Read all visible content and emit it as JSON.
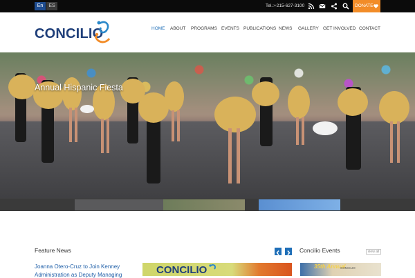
{
  "topbar": {
    "languages": [
      "En",
      "ES"
    ],
    "phone": "Tel.:+215-627-3100",
    "icons": [
      "rss-icon",
      "email-icon",
      "share-icon",
      "search-icon"
    ],
    "donate_label": "DONATE",
    "colors": {
      "bar": "#0b0b0b",
      "donate": "#f28c28",
      "lang_active": "#1f4d91"
    }
  },
  "header": {
    "logo_text": "CONCILIO",
    "nav": [
      "HOME",
      "ABOUT",
      "PROGRAMS",
      "EVENTS",
      "PUBLICATIONS",
      "NEWS",
      "GALLERY",
      "GET INVOLVED",
      "CONTACT"
    ],
    "active_nav": "HOME",
    "colors": {
      "brand": "#1f3f7a",
      "active": "#1f6fb8",
      "logo_orange": "#f28c28",
      "logo_blue": "#2a88c9"
    }
  },
  "hero": {
    "caption": "Annual Hispanic Fiesta"
  },
  "feature_news": {
    "title": "Feature News",
    "prev_icon": "chevron-left-icon",
    "next_icon": "chevron-right-icon",
    "headline_line1": "Joanna Otero-Cruz to Join Kenney",
    "headline_line2": "Administration as Deputy Managing",
    "image_text": "CONCILIO"
  },
  "events": {
    "title": "Concilio Events",
    "view_all": "view all",
    "badge_text": "35th Annual",
    "small_text": "CONCILIO"
  }
}
